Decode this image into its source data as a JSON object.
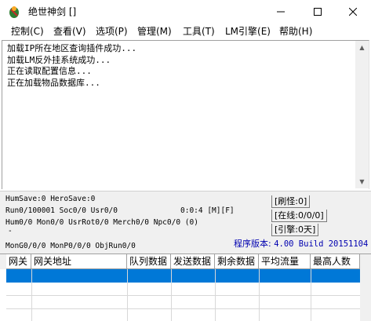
{
  "window": {
    "title": "绝世神剑 []",
    "controls": {
      "minimize": "—",
      "maximize": "☐",
      "close": "✕"
    }
  },
  "menu": [
    "控制(C)",
    "查看(V)",
    "选项(P)",
    "管理(M)",
    "工具(T)",
    "LM引擎(E)",
    "帮助(H)"
  ],
  "log": [
    "加载IP所在地区查询插件成功...",
    "加载LM反外挂系统成功...",
    "正在读取配置信息...",
    "正在加载物品数据库..."
  ],
  "status": {
    "line1": "HumSave:0 HeroSave:0",
    "line2": "Run0/100001 Soc0/0 Usr0/0",
    "timer": "0:0:4 [M][F]",
    "line3": "Hum0/0 Mon0/0 UsrRot0/0 Merch0/0 Npc0/0 (0)",
    "dash": "-",
    "line4": "MonG0/0/0 MonP0/0/0 ObjRun0/0",
    "refresh": "[刷怪:0]",
    "online": "[在线:0/0/0]",
    "engine": "[引擎:0天]",
    "version_label": "程序版本: ",
    "version_value": "4.00 Build 20151104"
  },
  "table": {
    "columns": [
      "网关",
      "网关地址",
      "队列数据",
      "发送数据",
      "剩余数据",
      "平均流量",
      "最高人数"
    ],
    "selected_row": 0
  }
}
